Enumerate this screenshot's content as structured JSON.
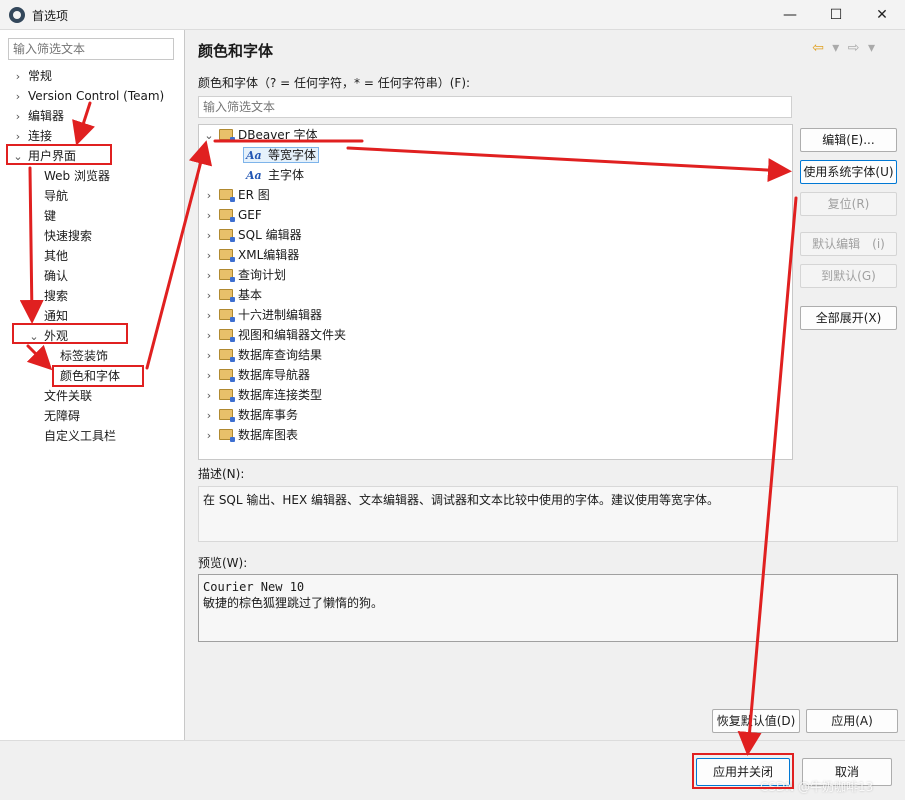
{
  "window": {
    "title": "首选项",
    "minimize": "—",
    "maximize": "☐",
    "close": "✕"
  },
  "sidebar": {
    "filter_placeholder": "输入筛选文本",
    "items": [
      {
        "label": "常规",
        "chevron": "›"
      },
      {
        "label": "Version Control (Team)",
        "chevron": "›"
      },
      {
        "label": "编辑器",
        "chevron": "›"
      },
      {
        "label": "连接",
        "chevron": "›"
      },
      {
        "label": "用户界面",
        "chevron": "⌄"
      },
      {
        "label": "Web 浏览器"
      },
      {
        "label": "导航"
      },
      {
        "label": "键"
      },
      {
        "label": "快速搜索"
      },
      {
        "label": "其他"
      },
      {
        "label": "确认"
      },
      {
        "label": "搜索"
      },
      {
        "label": "通知"
      },
      {
        "label": "外观",
        "chevron": "⌄"
      },
      {
        "label": "标签装饰"
      },
      {
        "label": "颜色和字体"
      },
      {
        "label": "文件关联"
      },
      {
        "label": "无障碍"
      },
      {
        "label": "自定义工具栏"
      }
    ]
  },
  "main": {
    "title": "颜色和字体",
    "subtitle": "颜色和字体（? = 任何字符，* = 任何字符串）(F):",
    "filter_placeholder": "输入筛选文本",
    "tree": [
      {
        "label": "DBeaver 字体",
        "chevron": "⌄"
      },
      {
        "label": "等宽字体",
        "icon": "Aa"
      },
      {
        "label": "主字体",
        "icon": "Aa"
      },
      {
        "label": "ER 图",
        "chevron": "›"
      },
      {
        "label": "GEF",
        "chevron": "›"
      },
      {
        "label": "SQL 编辑器",
        "chevron": "›"
      },
      {
        "label": "XML编辑器",
        "chevron": "›"
      },
      {
        "label": "查询计划",
        "chevron": "›"
      },
      {
        "label": "基本",
        "chevron": "›"
      },
      {
        "label": "十六进制编辑器",
        "chevron": "›"
      },
      {
        "label": "视图和编辑器文件夹",
        "chevron": "›"
      },
      {
        "label": "数据库查询结果",
        "chevron": "›"
      },
      {
        "label": "数据库导航器",
        "chevron": "›"
      },
      {
        "label": "数据库连接类型",
        "chevron": "›"
      },
      {
        "label": "数据库事务",
        "chevron": "›"
      },
      {
        "label": "数据库图表",
        "chevron": "›"
      }
    ],
    "buttons": {
      "edit": "编辑(E)...",
      "use_system_font": "使用系统字体(U)",
      "reset": "复位(R)",
      "default_edit": "默认编辑　(i)",
      "go_default": "到默认(G)",
      "expand_all": "全部展开(X)"
    },
    "description_label": "描述(N):",
    "description": "在 SQL 输出、HEX 编辑器、文本编辑器、调试器和文本比较中使用的字体。建议使用等宽字体。",
    "preview_label": "预览(W):",
    "preview_font": "Courier New 10",
    "preview_text": "敏捷的棕色狐狸跳过了懒惰的狗。",
    "restore_defaults": "恢复默认值(D)",
    "apply": "应用(A)"
  },
  "footer": {
    "apply_and_close": "应用并关闭",
    "cancel": "取消"
  },
  "nav": {
    "back": "⇦",
    "dropdown": "▾",
    "forward": "⇨"
  },
  "watermark": "CSDN @牛奶咖啡13",
  "colors": {
    "highlight": "#e02020",
    "selection": "#e5f1fb"
  }
}
